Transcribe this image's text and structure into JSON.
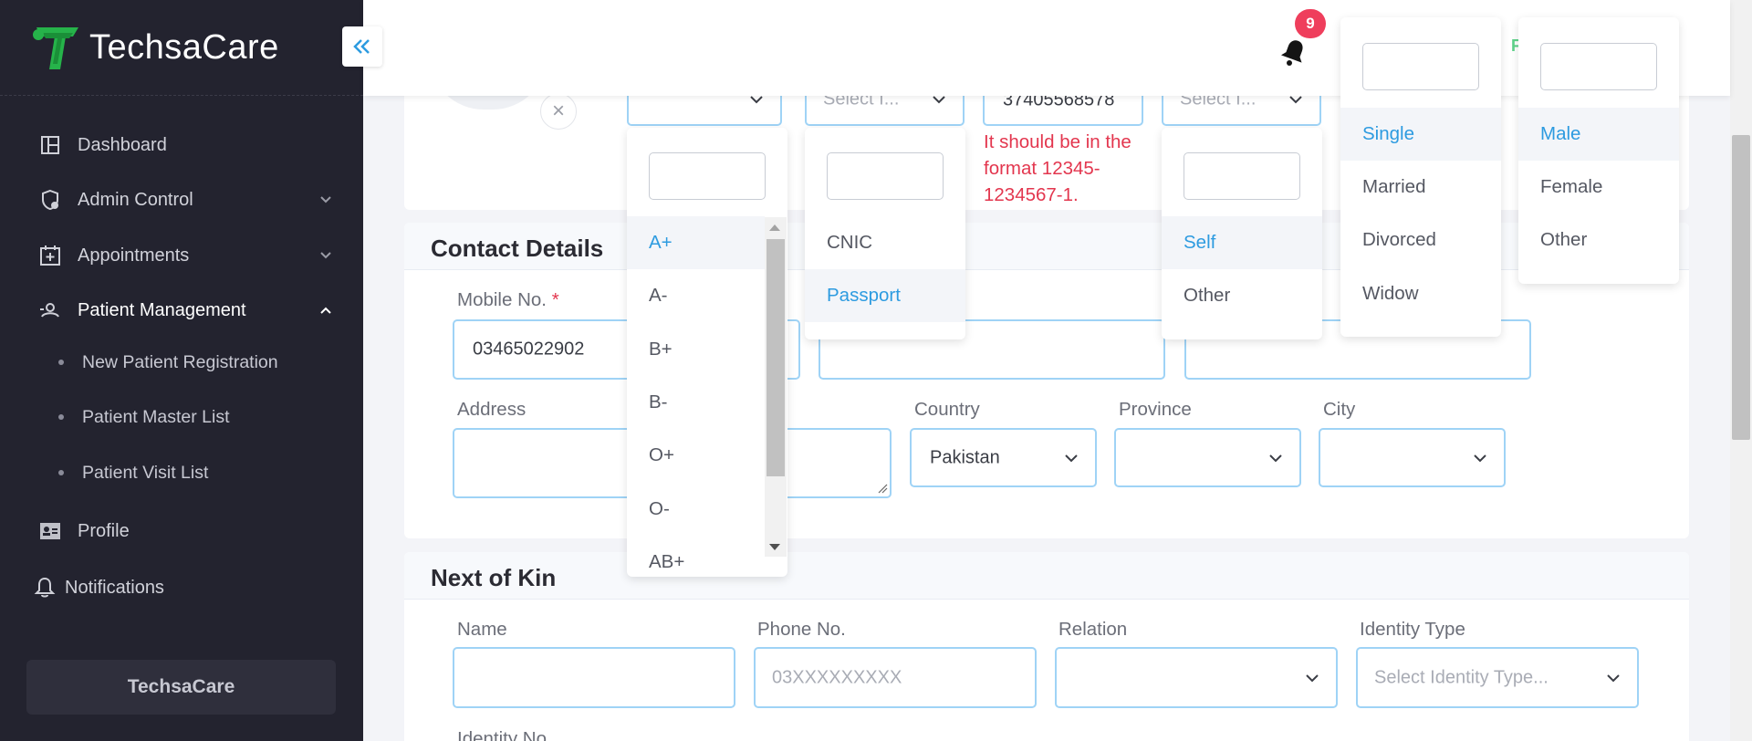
{
  "brand": {
    "name": "TechsaCare"
  },
  "sidebar": {
    "items": [
      {
        "label": "Dashboard",
        "icon": "dashboard-icon"
      },
      {
        "label": "Admin Control",
        "icon": "admin-settings-icon"
      },
      {
        "label": "Appointments",
        "icon": "calendar-plus-icon"
      },
      {
        "label": "Patient Management",
        "icon": "patient-icon"
      },
      {
        "label": "Profile",
        "icon": "profile-card-icon"
      },
      {
        "label": "Notifications",
        "icon": "bell-icon"
      }
    ],
    "sub_items": [
      {
        "label": "New Patient Registration"
      },
      {
        "label": "Patient Master List"
      },
      {
        "label": "Patient Visit List"
      }
    ],
    "footer": "TechsaCare"
  },
  "header": {
    "notification_count": "9",
    "peek_text": "F"
  },
  "top_row": {
    "id_type_placeholder": "Select I...",
    "identity_no_value": "37405568578",
    "relation_placeholder": "Select I...",
    "error": "It should be in the format 12345-1234567-1."
  },
  "contact": {
    "title": "Contact Details",
    "mobile_label": "Mobile No.",
    "mobile_required": "*",
    "mobile_value": "03465022902",
    "address_label": "Address",
    "country_label": "Country",
    "country_value": "Pakistan",
    "province_label": "Province",
    "city_label": "City"
  },
  "kin": {
    "title": "Next of Kin",
    "name_label": "Name",
    "phone_label": "Phone No.",
    "phone_placeholder": "03XXXXXXXXX",
    "relation_label": "Relation",
    "identity_type_label": "Identity Type",
    "identity_type_placeholder": "Select Identity Type...",
    "identity_no_label": "Identity No."
  },
  "dropdowns": {
    "blood_group": [
      "A+",
      "A-",
      "B+",
      "B-",
      "O+",
      "O-",
      "AB+"
    ],
    "identity_type": [
      "CNIC",
      "Passport"
    ],
    "relation": [
      "Self",
      "Other"
    ],
    "marital_status": [
      "Single",
      "Married",
      "Divorced",
      "Widow"
    ],
    "gender": [
      "Male",
      "Female",
      "Other"
    ]
  }
}
